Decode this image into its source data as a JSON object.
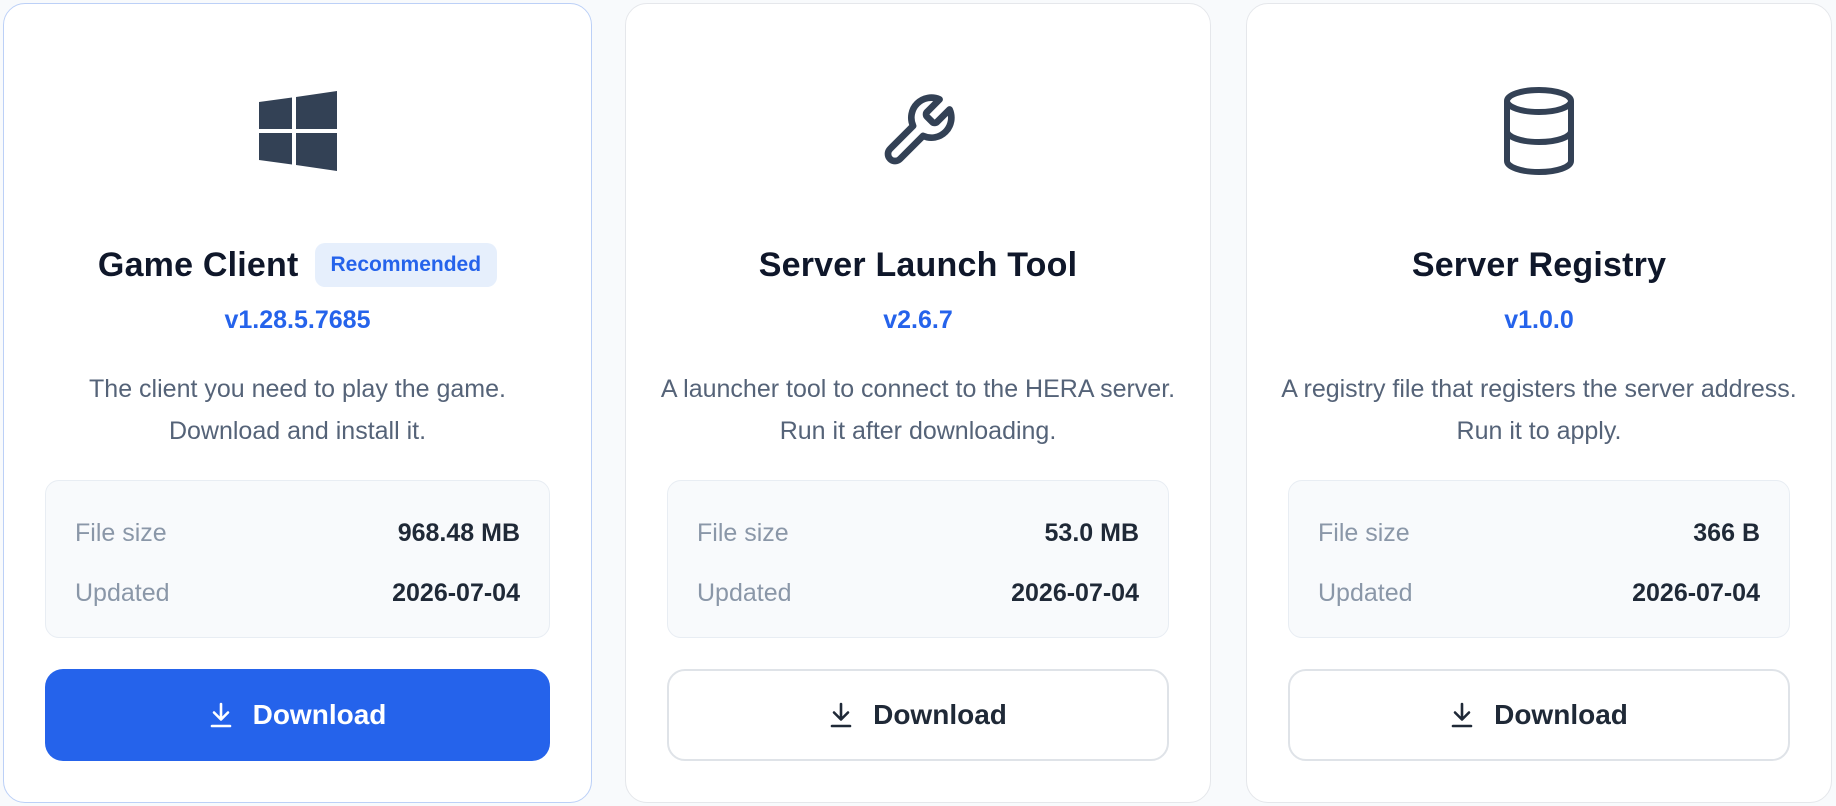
{
  "cards": [
    {
      "icon": "windows-icon",
      "title": "Game Client",
      "badge": "Recommended",
      "version": "v1.28.5.7685",
      "description": "The client you need to play the game. Download and install it.",
      "file_size_label": "File size",
      "file_size": "968.48 MB",
      "updated_label": "Updated",
      "updated": "2026-07-04",
      "download_label": "Download"
    },
    {
      "icon": "wrench-icon",
      "title": "Server Launch Tool",
      "version": "v2.6.7",
      "description": "A launcher tool to connect to the HERA server. Run it after downloading.",
      "file_size_label": "File size",
      "file_size": "53.0 MB",
      "updated_label": "Updated",
      "updated": "2026-07-04",
      "download_label": "Download"
    },
    {
      "icon": "database-icon",
      "title": "Server Registry",
      "version": "v1.0.0",
      "description": "A registry file that registers the server address. Run it to apply.",
      "file_size_label": "File size",
      "file_size": "366 B",
      "updated_label": "Updated",
      "updated": "2026-07-04",
      "download_label": "Download"
    }
  ],
  "colors": {
    "accent": "#2563eb",
    "badge_bg": "#e6effc",
    "icon": "#334155",
    "title": "#0f172a",
    "muted": "#8a97a8"
  }
}
